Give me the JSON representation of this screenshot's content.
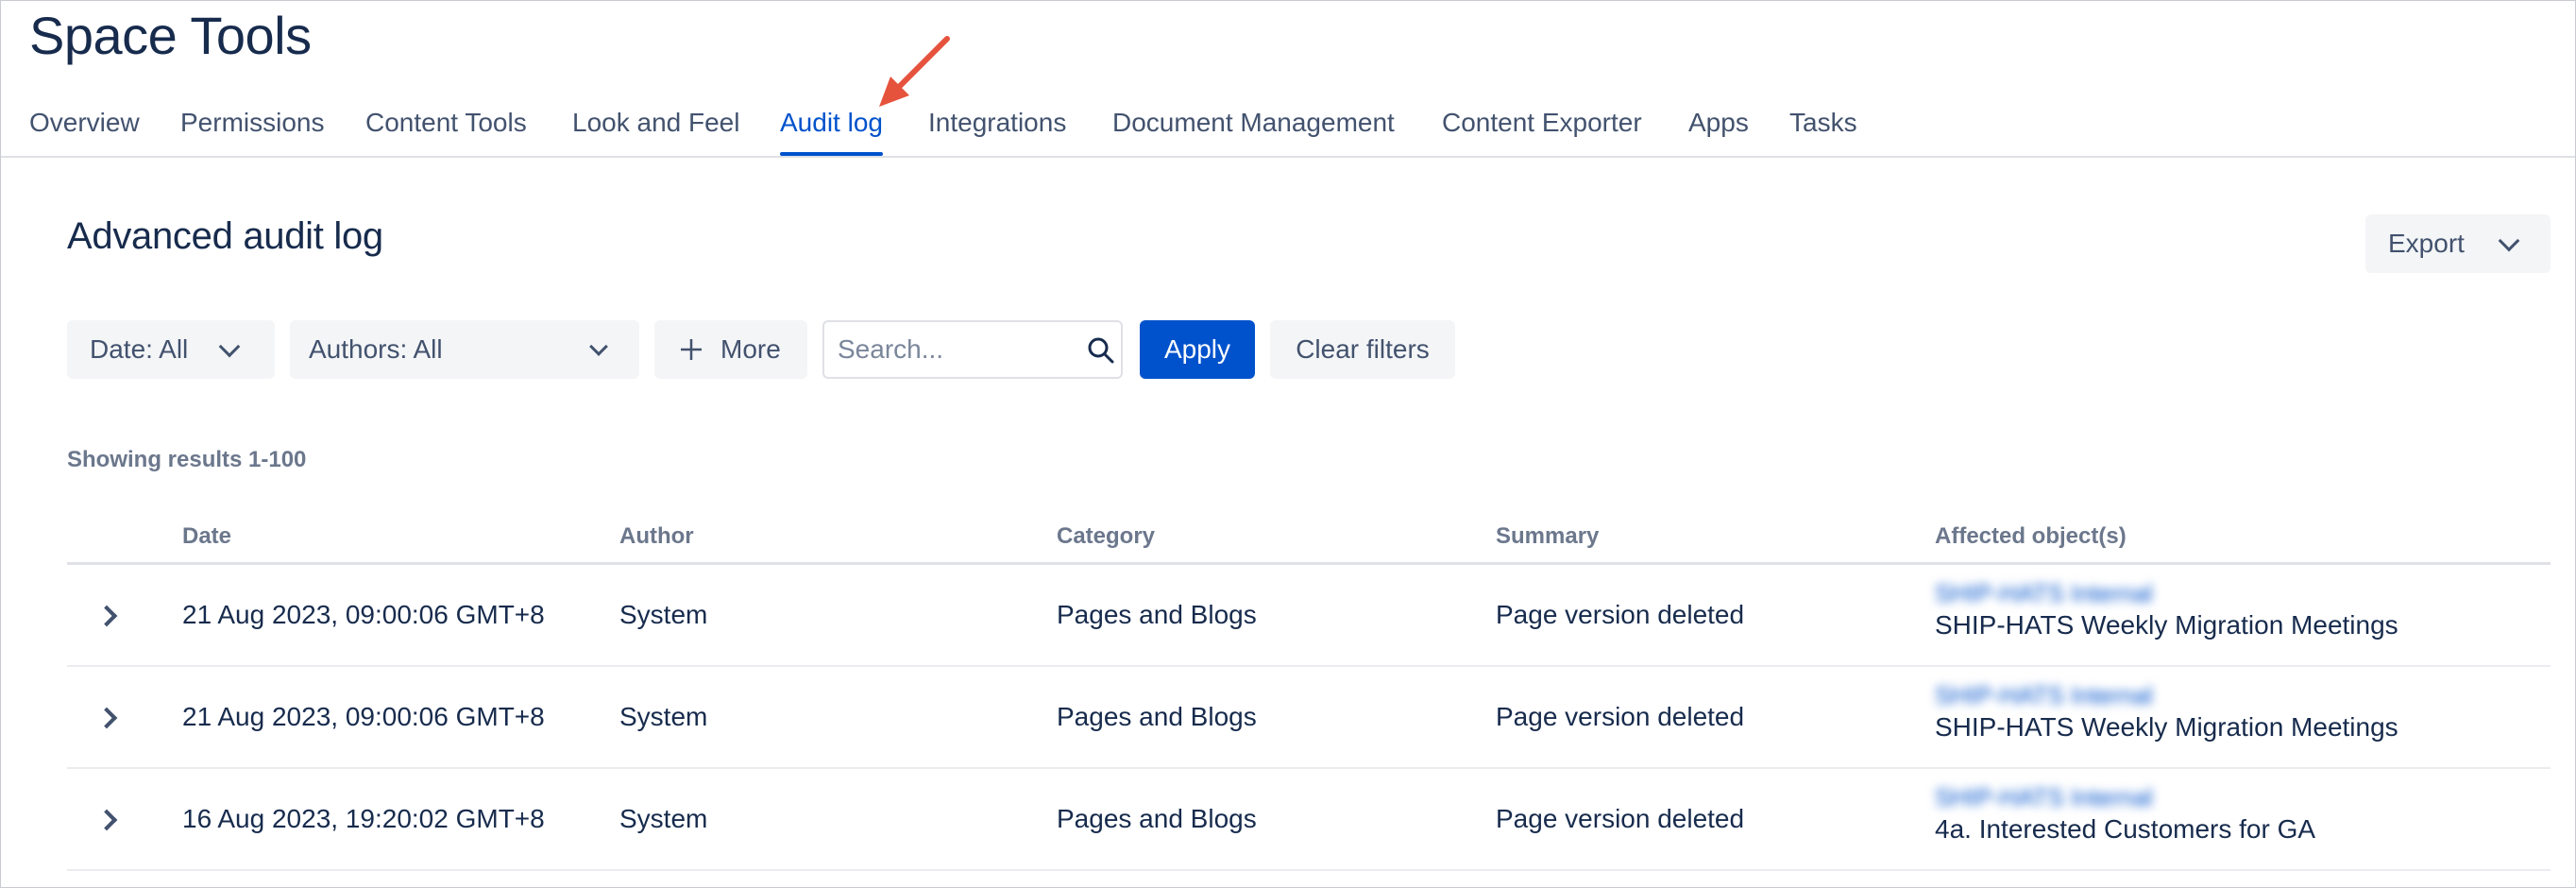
{
  "page_title": "Space Tools",
  "tabs": [
    {
      "label": "Overview"
    },
    {
      "label": "Permissions"
    },
    {
      "label": "Content Tools"
    },
    {
      "label": "Look and Feel"
    },
    {
      "label": "Audit log",
      "active": true
    },
    {
      "label": "Integrations"
    },
    {
      "label": "Document Management"
    },
    {
      "label": "Content Exporter"
    },
    {
      "label": "Apps"
    },
    {
      "label": "Tasks"
    }
  ],
  "main": {
    "title": "Advanced audit log",
    "export_label": "Export",
    "filters": {
      "date_label": "Date: All",
      "authors_label": "Authors: All",
      "more_label": "More",
      "search_placeholder": "Search...",
      "apply_label": "Apply",
      "clear_label": "Clear filters"
    },
    "results_text": "Showing results 1-100",
    "table": {
      "headers": {
        "date": "Date",
        "author": "Author",
        "category": "Category",
        "summary": "Summary",
        "affected": "Affected object(s)"
      },
      "rows": [
        {
          "date": "21 Aug 2023, 09:00:06 GMT+8",
          "author": "System",
          "category": "Pages and Blogs",
          "summary": "Page version deleted",
          "affected_space": "SHIP-HATS Internal",
          "affected_page": "SHIP-HATS Weekly Migration Meetings"
        },
        {
          "date": "21 Aug 2023, 09:00:06 GMT+8",
          "author": "System",
          "category": "Pages and Blogs",
          "summary": "Page version deleted",
          "affected_space": "SHIP-HATS Internal",
          "affected_page": "SHIP-HATS Weekly Migration Meetings"
        },
        {
          "date": "16 Aug 2023, 19:20:02 GMT+8",
          "author": "System",
          "category": "Pages and Blogs",
          "summary": "Page version deleted",
          "affected_space": "SHIP-HATS Internal",
          "affected_page": "4a. Interested Customers for GA"
        }
      ]
    }
  },
  "colors": {
    "accent": "#0052cc",
    "text": "#172b4d",
    "subtle_text": "#6b778c",
    "button_bg": "#f4f5f7",
    "annotation_arrow": "#e5533d"
  },
  "icons": {
    "export_chevron": "chevron-down-icon",
    "date_chevron": "chevron-down-icon",
    "authors_chevron": "chevron-down-icon",
    "more_plus": "plus-icon",
    "search": "search-icon",
    "row_expand": "chevron-right-icon",
    "annotation": "red-arrow-annotation-icon"
  }
}
